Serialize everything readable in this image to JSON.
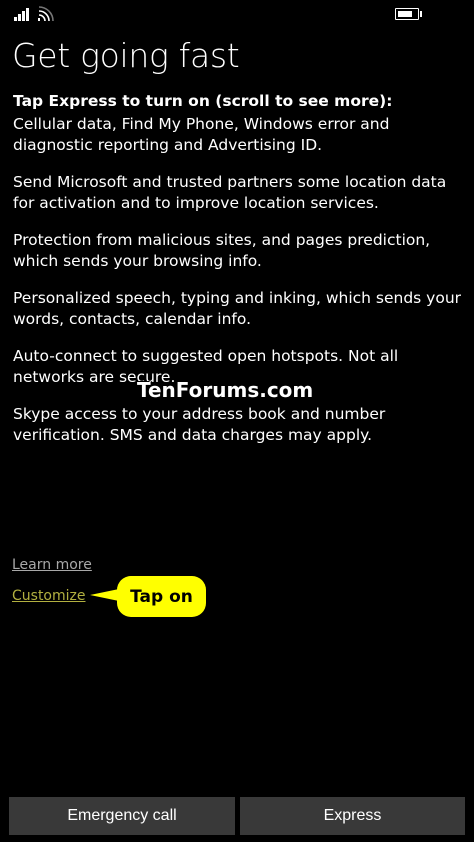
{
  "status": {
    "signal_bars": 4,
    "battery_level": 0.85
  },
  "page": {
    "title": "Get going fast",
    "intro": "Tap Express to turn on (scroll to see more):",
    "paragraphs": [
      "Cellular data, Find My Phone, Windows error and diagnostic reporting and Advertising ID.",
      "Send Microsoft and trusted partners some location data for activation and to improve location services.",
      "Protection from malicious sites, and pages prediction, which sends your browsing info.",
      "Personalized speech, typing and inking, which sends your words, contacts, calendar info.",
      "Auto-connect to suggested open hotspots. Not all networks are secure.",
      "Skype access to your address book and number verification. SMS and data charges may apply."
    ]
  },
  "watermark": "TenForums.com",
  "links": {
    "learn_more": "Learn more",
    "customize": "Customize"
  },
  "callout": {
    "text": "Tap on",
    "color": "#ffff00"
  },
  "buttons": {
    "emergency_call": "Emergency call",
    "express": "Express"
  },
  "colors": {
    "background": "#000000",
    "button_bg": "#393939",
    "customize_link": "#b2b040"
  }
}
